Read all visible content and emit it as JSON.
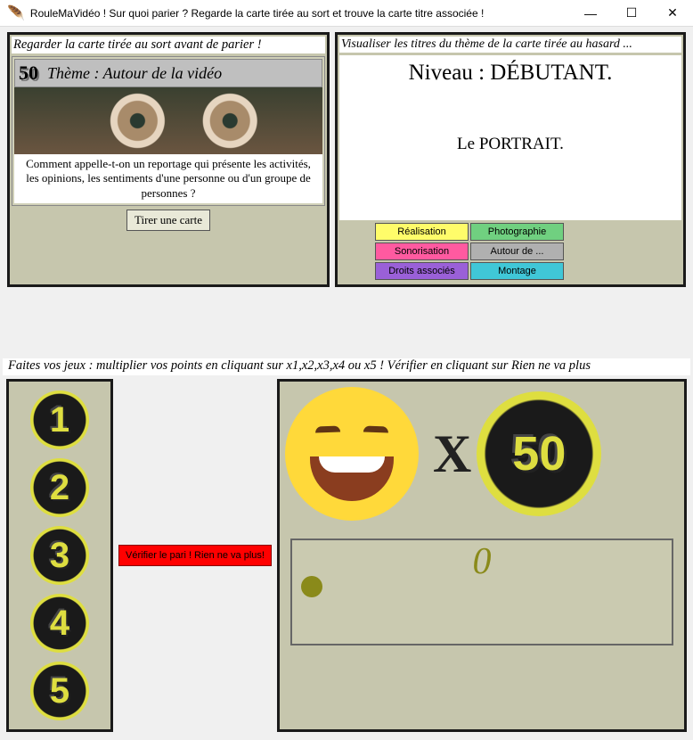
{
  "titlebar": {
    "title": "RouleMaVidéo ! Sur quoi parier ? Regarde la carte tirée au sort et trouve la carte titre associée !"
  },
  "card": {
    "header": "Regarder la carte tirée au sort avant de parier !",
    "number": "50",
    "theme": "Thème : Autour de la vidéo",
    "question": "Comment appelle-t-on un reportage qui présente les activités, les opinions, les sentiments d'une personne ou d'un groupe de personnes ?",
    "draw_btn": "Tirer une carte"
  },
  "right": {
    "header": "Visualiser les titres du thème de la carte tirée au hasard ...",
    "level": "Niveau : DÉBUTANT.",
    "answer": "Le PORTRAIT.",
    "categories": [
      "Réalisation",
      "Photographie",
      "Sonorisation",
      "Autour de ...",
      "Droits associés",
      "Montage"
    ]
  },
  "bet": {
    "instructions": "Faites vos jeux : multiplier vos points en cliquant sur x1,x2,x3,x4 ou x5 ! Vérifier en cliquant sur Rien ne va plus",
    "coins": [
      "1",
      "2",
      "3",
      "4",
      "5"
    ],
    "verify_btn": "Vérifier le pari ! Rien ne va plus!",
    "x_label": "X",
    "bigcoin": "50",
    "slider_value": "0"
  }
}
